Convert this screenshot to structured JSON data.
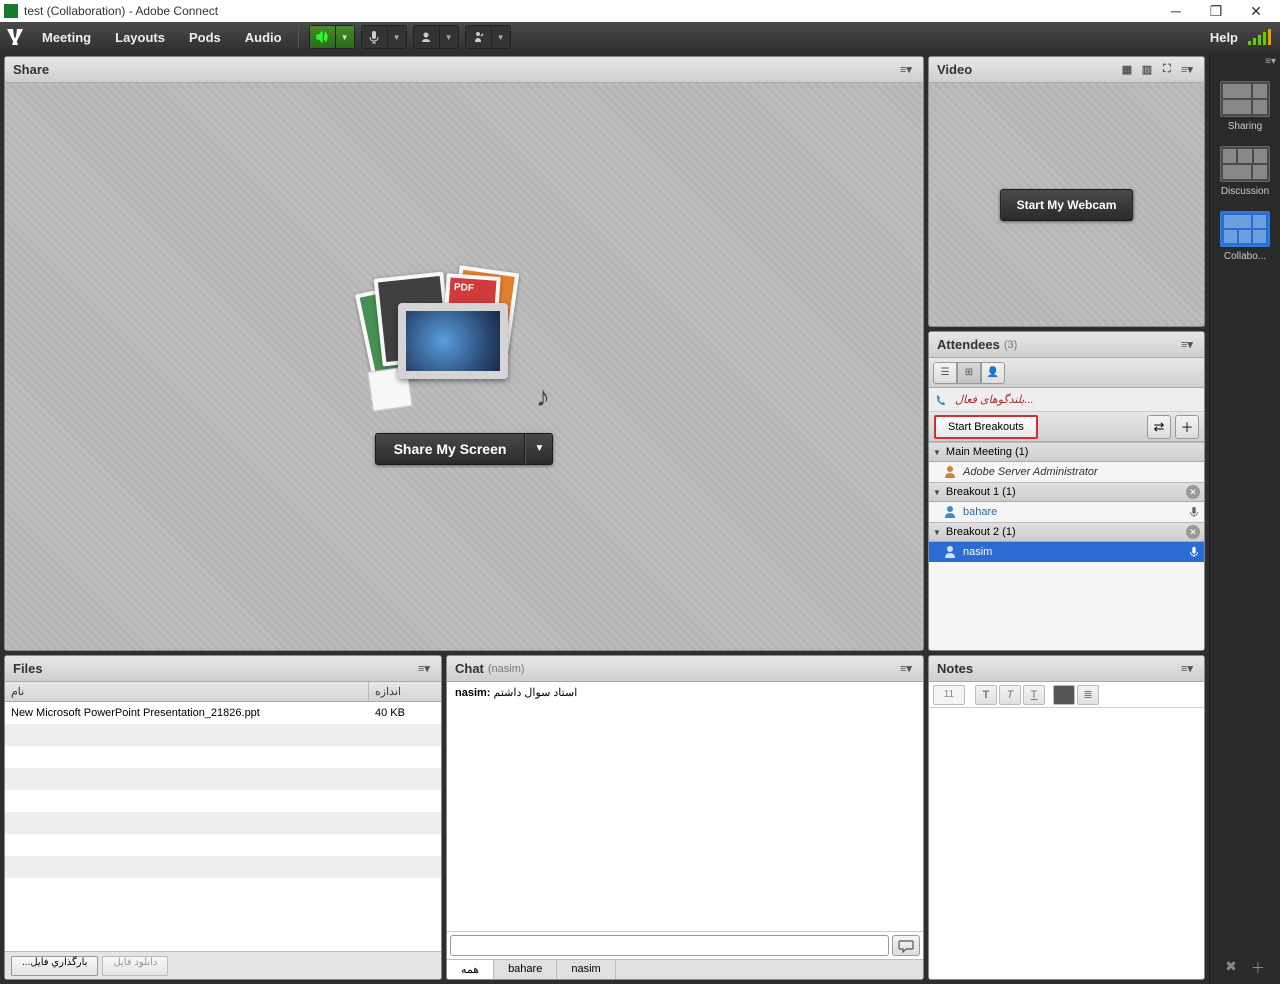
{
  "titlebar": {
    "title": "test (Collaboration) - Adobe Connect"
  },
  "menubar": {
    "logo": "Adobe",
    "meeting": "Meeting",
    "layouts": "Layouts",
    "pods": "Pods",
    "audio": "Audio",
    "help": "Help"
  },
  "layouts": {
    "sharing": "Sharing",
    "discussion": "Discussion",
    "collaboration": "Collabo..."
  },
  "share": {
    "title": "Share",
    "button": "Share My Screen"
  },
  "video": {
    "title": "Video",
    "webcam": "Start My Webcam"
  },
  "attendees": {
    "title": "Attendees",
    "count": "(3)",
    "activeSpeakers": "بلندگوهای فعال...",
    "startBreakouts": "Start Breakouts",
    "groups": {
      "main": "Main Meeting (1)",
      "b1": "Breakout 1 (1)",
      "b2": "Breakout 2 (1)"
    },
    "users": {
      "admin": "Adobe Server Administrator",
      "bahare": "bahare",
      "nasim": "nasim"
    }
  },
  "files": {
    "title": "Files",
    "col_name": "نام",
    "col_size": "اندازه",
    "rows": [
      {
        "name": "New Microsoft PowerPoint Presentation_21826.ppt",
        "size": "40 KB"
      }
    ],
    "upload": "...بارگذاري فايل",
    "download": "دانلود فايل"
  },
  "chat": {
    "title": "Chat",
    "sub": "(nasim)",
    "msg_from": "nasim:",
    "msg_text": "استاد سوال داشتم",
    "tabs": {
      "all": "همه",
      "bahare": "bahare",
      "nasim": "nasim"
    }
  },
  "notes": {
    "title": "Notes",
    "fontsize": "11"
  }
}
